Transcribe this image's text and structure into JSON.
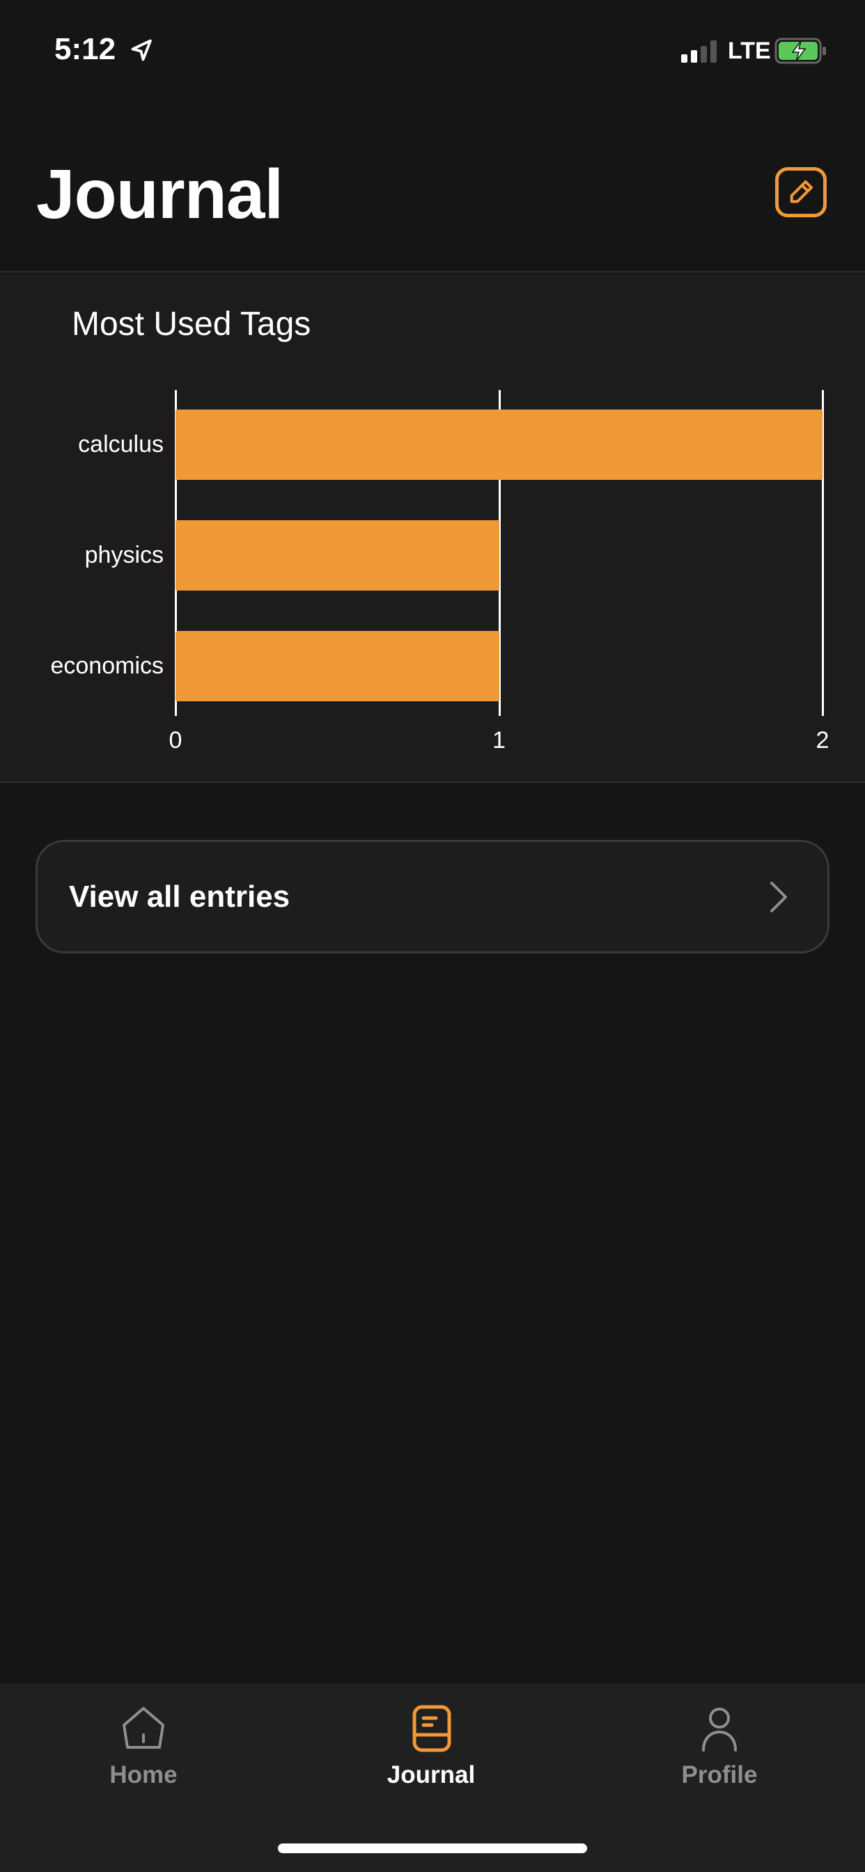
{
  "status_bar": {
    "time": "5:12",
    "network": "LTE",
    "battery_color": "#5ac85a"
  },
  "header": {
    "title": "Journal",
    "edit_icon": "pencil-square-icon"
  },
  "accent_color": "#F09A37",
  "chart_data": {
    "type": "bar",
    "orientation": "horizontal",
    "title": "Most Used Tags",
    "categories": [
      "calculus",
      "physics",
      "economics"
    ],
    "values": [
      2,
      1,
      1
    ],
    "xlim": [
      0,
      2
    ],
    "x_ticks": [
      "0",
      "1",
      "2"
    ],
    "grid": true,
    "color": "#F09A37"
  },
  "view_all": {
    "label": "View all entries"
  },
  "tabbar": {
    "items": [
      {
        "label": "Home",
        "icon": "home-icon"
      },
      {
        "label": "Journal",
        "icon": "journal-icon",
        "active": true
      },
      {
        "label": "Profile",
        "icon": "person-icon"
      }
    ]
  }
}
